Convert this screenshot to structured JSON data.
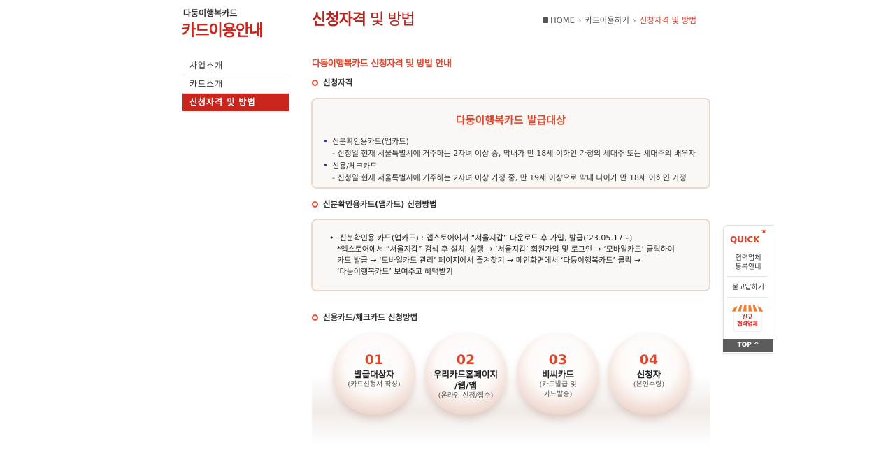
{
  "brand": {
    "small": "다둥이행복카드",
    "big": "카드이용안내"
  },
  "sidebar": {
    "items": [
      {
        "label": "사업소개"
      },
      {
        "label": "카드소개"
      },
      {
        "label": "신청자격 및 방법"
      }
    ],
    "active_index": 2
  },
  "header": {
    "title_bold": "신청자격",
    "title_thin": " 및 방법",
    "breadcrumb": [
      "HOME",
      "카드이용하기",
      "신청자격 및 방법"
    ]
  },
  "content": {
    "section_title": "다둥이행복카드 신청자격 및 방법 안내",
    "eligibility": {
      "heading": "신청자격",
      "box_title": "다둥이행복카드 발급대상",
      "items": [
        {
          "title": "신분확인용카드(앱카드)",
          "desc": "- 신청일 현재 서울특별시에 거주하는 2자녀 이상 중, 막내가 만 18세 이하인 가정의 세대주 또는 세대주의 배우자"
        },
        {
          "title": "신용/체크카드",
          "desc": "- 신청일 현재 서울특별시에 거주하는 2자녀 이상 가정 중, 만 19세 이상으로 막내 나이가 만 18세 이하인 가정"
        }
      ]
    },
    "app_card": {
      "heading": "신분확인용카드(앱카드) 신청방법",
      "lines": [
        "신분확인용 카드(앱카드) : 앱스토어에서 “서울지갑” 다운로드 후 가입, 발급(’23.05.17~)",
        "*앱스토어에서 “서울지갑” 검색 후 설치, 실행 → ‘서울지갑’ 회원가입 및 로그인 → ‘모바일카드’ 클릭하여",
        "카드 발급 → ‘모바일카드 관리’ 페이지에서 즐겨찾기 → 메인화면에서 ‘다둥이행복카드’ 클릭 →",
        "‘다둥이행복카드’ 보여주고 혜택받기"
      ]
    },
    "credit_card": {
      "heading": "신용카드/체크카드 신청방법",
      "steps": [
        {
          "num": "01",
          "title": "발급대상자",
          "sub": "(카드신청서 작성)"
        },
        {
          "num": "02",
          "title": "우리카드홈페이지/웹/앱",
          "title_l1": "우리카드홈페이지",
          "title_l2": "/웹/앱",
          "sub": "(온라인 신청/접수)"
        },
        {
          "num": "03",
          "title": "비씨카드",
          "sub": "(카드발급 및 카드발송)",
          "sub_l1": "(카드발급 및",
          "sub_l2": "카드발송)"
        },
        {
          "num": "04",
          "title": "신청자",
          "sub": "(본인수령)"
        }
      ]
    }
  },
  "quick": {
    "title": "QUICK",
    "links": [
      "협력업체 등록안내",
      "묻고답하기"
    ],
    "link0_l1": "협력업체",
    "link0_l2": "등록안내",
    "new_label_l1": "신규",
    "new_label_l2": "협력업체",
    "top": "TOP"
  },
  "colors": {
    "accent": "#c9251c",
    "orange": "#e0462c",
    "box_border": "#ead7cd"
  }
}
